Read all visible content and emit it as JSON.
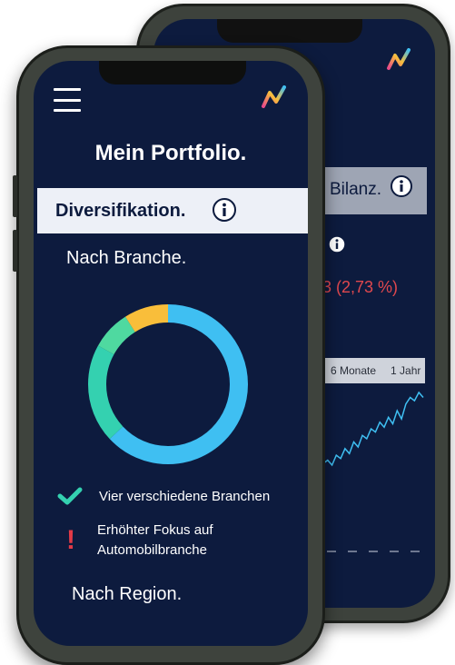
{
  "back_phone": {
    "section_label": "Bilanz.",
    "change_text": "3 (2,73 %)",
    "range_options": [
      "6 Monate",
      "1 Jahr"
    ],
    "chart_series": [
      40,
      44,
      38,
      50,
      46,
      58,
      52,
      66,
      60,
      74,
      70,
      82,
      78,
      90,
      84,
      96,
      88,
      104,
      94,
      112,
      120,
      116,
      126,
      120
    ]
  },
  "front_phone": {
    "page_title": "Mein Portfolio.",
    "section_label": "Diversifikation.",
    "sub_heading_branche": "Nach Branche.",
    "sub_heading_region": "Nach Region.",
    "donut": {
      "segments": [
        {
          "color": "#3fbff2",
          "fraction": 0.63
        },
        {
          "color": "#34d1b0",
          "fraction": 0.2
        },
        {
          "color": "#4fd9a0",
          "fraction": 0.08
        },
        {
          "color": "#f9be3a",
          "fraction": 0.09
        }
      ]
    },
    "check_text": "Vier verschiedene Branchen",
    "warning_text_line1": "Erhöhter Fokus auf",
    "warning_text_line2": "Automobilbranche"
  },
  "colors": {
    "screen_bg": "#0d1b3e",
    "check": "#34d1b0",
    "warning": "#e23a47"
  }
}
